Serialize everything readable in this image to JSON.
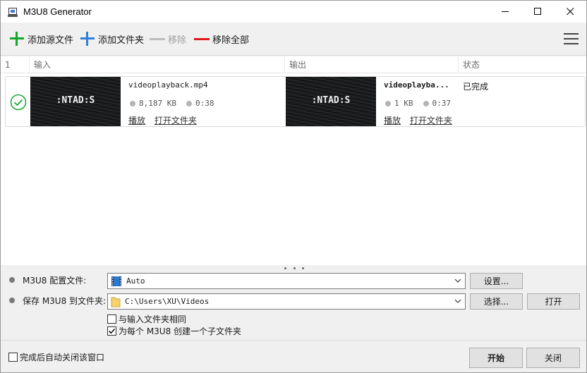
{
  "window": {
    "title": "M3U8 Generator",
    "controls": {
      "minimize": "minimize-icon",
      "maximize": "maximize-icon",
      "close": "close-icon"
    }
  },
  "toolbar": {
    "add_source_file": "添加源文件",
    "add_folder": "添加文件夹",
    "remove": "移除",
    "remove_all": "移除全部"
  },
  "list": {
    "headers": {
      "index": "1",
      "input": "输入",
      "output": "输出",
      "status": "状态"
    },
    "rows": [
      {
        "input": {
          "filename": "videoplayback.mp4",
          "size": "8,187 KB",
          "duration": "0:38",
          "play": "播放",
          "open_folder": "打开文件夹",
          "thumb_text": ":NTAD:S"
        },
        "output": {
          "filename": "videoplayba...",
          "size": "1 KB",
          "duration": "0:37",
          "play": "播放",
          "open_folder": "打开文件夹",
          "thumb_text": ":NTAD:S"
        },
        "status": "已完成"
      }
    ]
  },
  "settings": {
    "profile_label": "M3U8 配置文件:",
    "profile_value": "Auto",
    "profile_button": "设置...",
    "save_label": "保存 M3U8 到文件夹:",
    "save_value": "C:\\Users\\XU\\Videos",
    "choose_button": "选择...",
    "open_button": "打开",
    "same_as_input": "与输入文件夹相同",
    "same_as_input_checked": false,
    "create_subfolder": "为每个 M3U8 创建一个子文件夹",
    "create_subfolder_checked": true
  },
  "footer": {
    "auto_close": "完成后自动关闭该窗口",
    "auto_close_checked": false,
    "start": "开始",
    "close": "关闭"
  },
  "colors": {
    "success": "#1ea63a",
    "add_green": "#17a52c",
    "add_blue": "#2d7fd8",
    "remove_red": "#e01919"
  }
}
